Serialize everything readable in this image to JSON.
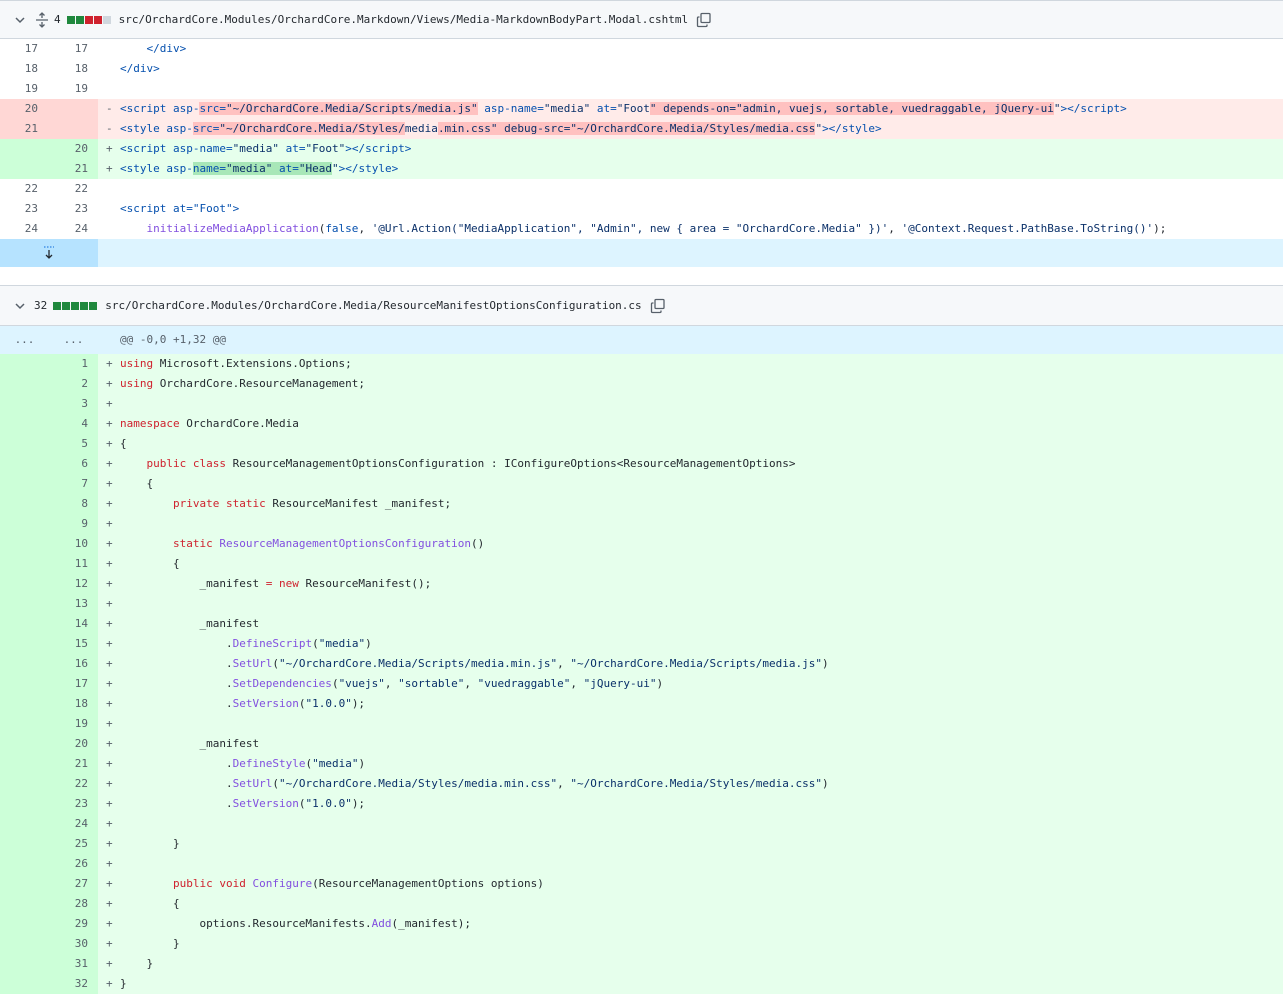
{
  "files": [
    {
      "change_count": "4",
      "path": "src/OrchardCore.Modules/OrchardCore.Markdown/Views/Media-MarkdownBodyPart.Modal.cshtml",
      "blocks": [
        "add",
        "add",
        "del",
        "del",
        "neu"
      ]
    },
    {
      "change_count": "32",
      "path": "src/OrchardCore.Modules/OrchardCore.Media/ResourceManifestOptionsConfiguration.cs",
      "blocks": [
        "add",
        "add",
        "add",
        "add",
        "add"
      ]
    }
  ],
  "diff1": {
    "rows": [
      {
        "type": "ctx",
        "old": "17",
        "new": "17",
        "code": "    </div>"
      },
      {
        "type": "ctx",
        "old": "18",
        "new": "18",
        "code": "</div>"
      },
      {
        "type": "ctx",
        "old": "19",
        "new": "19",
        "code": ""
      },
      {
        "type": "del",
        "old": "20",
        "new": "",
        "sign": "-"
      },
      {
        "type": "del",
        "old": "21",
        "new": "",
        "sign": "-"
      },
      {
        "type": "add",
        "old": "",
        "new": "20",
        "sign": "+"
      },
      {
        "type": "add",
        "old": "",
        "new": "21",
        "sign": "+"
      },
      {
        "type": "ctx",
        "old": "22",
        "new": "22",
        "code": ""
      },
      {
        "type": "ctx",
        "old": "23",
        "new": "23",
        "code": "<script at=\"Foot\">"
      },
      {
        "type": "ctx",
        "old": "24",
        "new": "24"
      }
    ]
  },
  "diff2": {
    "hunk_old": "...",
    "hunk_new": "...",
    "hunk_header": "@@ -0,0 +1,32 @@",
    "sign": "+",
    "lines": [
      "1",
      "2",
      "3",
      "4",
      "5",
      "6",
      "7",
      "8",
      "9",
      "10",
      "11",
      "12",
      "13",
      "14",
      "15",
      "16",
      "17",
      "18",
      "19",
      "20",
      "21",
      "22",
      "23",
      "24",
      "25",
      "26",
      "27",
      "28",
      "29",
      "30",
      "31",
      "32"
    ]
  },
  "code_text": {
    "d1_17": "    </div>",
    "d1_18": "</div>",
    "d1_23": "<script at=\"Foot\">"
  },
  "colors": {
    "add_bg": "#e6ffec",
    "add_gutter": "#ccffd8",
    "del_bg": "#ffebe9",
    "del_gutter": "#ffd7d5",
    "hunk_bg": "#ddf4ff"
  },
  "icons": [
    "chevron-down-icon",
    "unfold-icon",
    "copy-icon",
    "expand-down-icon"
  ]
}
